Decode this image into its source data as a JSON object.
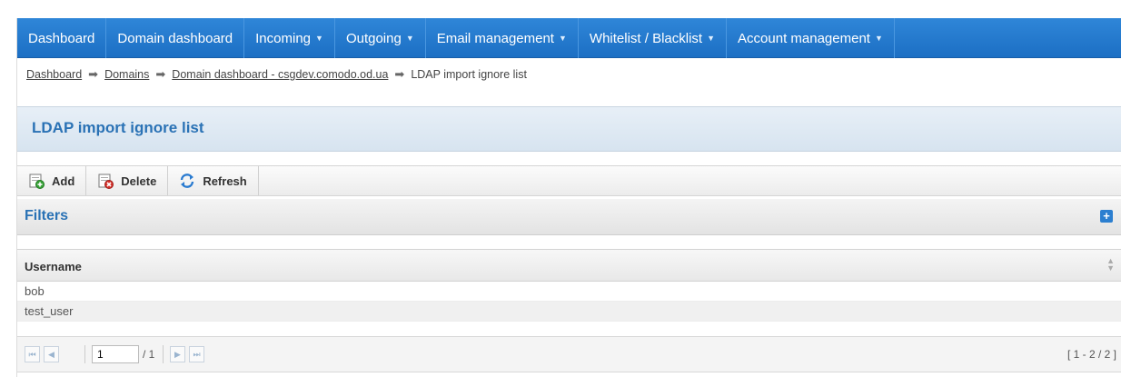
{
  "nav": {
    "items": [
      {
        "label": "Dashboard",
        "dropdown": false
      },
      {
        "label": "Domain dashboard",
        "dropdown": false
      },
      {
        "label": "Incoming",
        "dropdown": true
      },
      {
        "label": "Outgoing",
        "dropdown": true
      },
      {
        "label": "Email management",
        "dropdown": true
      },
      {
        "label": "Whitelist / Blacklist",
        "dropdown": true
      },
      {
        "label": "Account management",
        "dropdown": true
      }
    ],
    "caret": "▼"
  },
  "breadcrumb": {
    "links": [
      "Dashboard",
      "Domains",
      "Domain dashboard - csgdev.comodo.od.ua"
    ],
    "current": "LDAP import ignore list",
    "separator": "➡"
  },
  "page": {
    "title": "LDAP import ignore list"
  },
  "toolbar": {
    "add_label": "Add",
    "delete_label": "Delete",
    "refresh_label": "Refresh"
  },
  "filters": {
    "label": "Filters",
    "expand_symbol": "+"
  },
  "table": {
    "column": "Username",
    "sort_symbol": "▲▼",
    "rows": [
      "bob",
      "test_user"
    ]
  },
  "pager": {
    "first": "⏮",
    "prev": "◀",
    "next": "▶",
    "last": "⏭",
    "page_value": "1",
    "total_pages": "/ 1",
    "range": "[ 1 - 2 / 2 ]"
  },
  "colors": {
    "nav_bg": "#1c6fc4",
    "title_text": "#2a72b5"
  }
}
